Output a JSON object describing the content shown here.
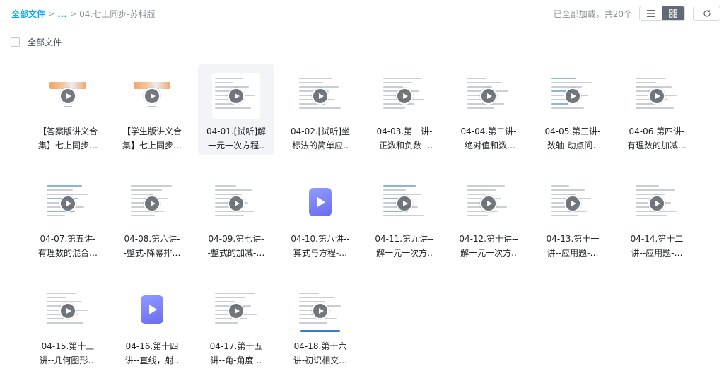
{
  "breadcrumb": {
    "root": "全部文件",
    "sep1": ">",
    "more": "...",
    "sep2": ">",
    "current": "04.七上同步-苏科版"
  },
  "status": {
    "text": "已全部加载，共20个"
  },
  "view": {
    "list_icon": "list-icon",
    "grid_icon": "grid-icon",
    "refresh_icon": "refresh-icon",
    "active": "grid"
  },
  "select_all": {
    "label": "全部文件"
  },
  "colors": {
    "accent": "#06a7ff",
    "video_icon": "#7b7ff5"
  },
  "files": [
    {
      "line1": "【答案版讲义合",
      "line2": "集】七上同步…",
      "thumb": "banner"
    },
    {
      "line1": "【学生版讲义合",
      "line2": "集】七上同步…",
      "thumb": "banner"
    },
    {
      "line1": "04-01.[试听]解",
      "line2": "一元一次方程..",
      "thumb": "doc",
      "hover": true
    },
    {
      "line1": "04-02.[试听]坐",
      "line2": "标法的简单应..",
      "thumb": "doc"
    },
    {
      "line1": "04-03.第一讲-",
      "line2": "-正数和负数-…",
      "thumb": "doc"
    },
    {
      "line1": "04-04.第二讲-",
      "line2": "-绝对值和数…",
      "thumb": "doc"
    },
    {
      "line1": "04-05.第三讲-",
      "line2": "-数轴-动点问…",
      "thumb": "doc-blue"
    },
    {
      "line1": "04-06.第四讲-",
      "line2": "有理数的加减…",
      "thumb": "doc"
    },
    {
      "line1": "04-07.第五讲-",
      "line2": "有理数的混合…",
      "thumb": "doc-blue"
    },
    {
      "line1": "04-08.第六讲-",
      "line2": "-整式-降幂排…",
      "thumb": "doc"
    },
    {
      "line1": "04-09.第七讲-",
      "line2": "-整式的加减-…",
      "thumb": "doc"
    },
    {
      "line1": "04-10.第八讲--",
      "line2": "算式与方程-…",
      "thumb": "video"
    },
    {
      "line1": "04-11.第九讲--",
      "line2": "解一元一次方..",
      "thumb": "doc-blue"
    },
    {
      "line1": "04-12.第十讲--",
      "line2": "解一元一次方..",
      "thumb": "doc"
    },
    {
      "line1": "04-13.第十一",
      "line2": "讲--应用题-…",
      "thumb": "doc"
    },
    {
      "line1": "04-14.第十二",
      "line2": "讲--应用题-…",
      "thumb": "doc"
    },
    {
      "line1": "04-15.第十三",
      "line2": "讲--几何图形…",
      "thumb": "doc"
    },
    {
      "line1": "04-16.第十四",
      "line2": "讲--直线，射..",
      "thumb": "video"
    },
    {
      "line1": "04-17.第十五",
      "line2": "讲--角-角度…",
      "thumb": "doc"
    },
    {
      "line1": "04-18.第十六",
      "line2": "讲-初识相交…",
      "thumb": "doc-bar"
    }
  ]
}
